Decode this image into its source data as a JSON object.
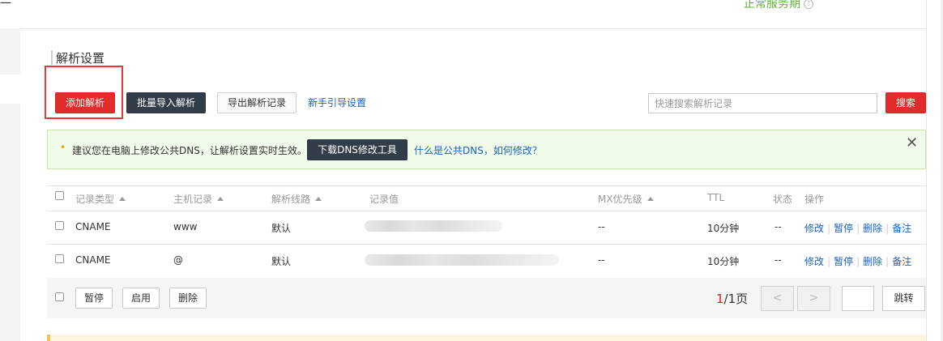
{
  "header": {
    "top_left_glyph": "一",
    "service_status": "正常服务期",
    "status_help_icon": "question-circle-icon"
  },
  "section_title": "解析设置",
  "toolbar": {
    "add_label": "添加解析",
    "batch_import_label": "批量导入解析",
    "export_label": "导出解析记录",
    "guide_link": "新手引导设置",
    "search_placeholder": "快速搜索解析记录",
    "search_button": "搜索"
  },
  "notice": {
    "bullet": "•",
    "text": "建议您在电脑上修改公共DNS，让解析设置实时生效。",
    "tool_button": "下载DNS修改工具",
    "help_link": "什么是公共DNS，如何修改？",
    "close_icon": "close-icon",
    "close_glyph": "✕"
  },
  "table": {
    "columns": {
      "type": "记录类型",
      "host": "主机记录",
      "line": "解析线路",
      "value": "记录值",
      "mx": "MX优先级",
      "ttl": "TTL",
      "status": "状态",
      "ops": "操作"
    },
    "rows": [
      {
        "type": "CNAME",
        "host": "www",
        "line": "默认",
        "value": "",
        "mx": "--",
        "ttl": "10分钟",
        "status": "--"
      },
      {
        "type": "CNAME",
        "host": "@",
        "line": "默认",
        "value": "",
        "mx": "--",
        "ttl": "10分钟",
        "status": "--"
      }
    ],
    "row_actions": {
      "edit": "修改",
      "pause": "暂停",
      "delete": "删除",
      "note": "备注",
      "separator": "|"
    }
  },
  "footer": {
    "pause_label": "暂停",
    "enable_label": "启用",
    "delete_label": "删除",
    "pager": {
      "current": "1",
      "total_text": "/1页"
    },
    "prev_glyph": "<",
    "next_glyph": ">",
    "jump_label": "跳转"
  },
  "colors": {
    "accent_red": "#e22b2b",
    "dark_button": "#333d4a",
    "link_blue": "#1a62b8",
    "status_green": "#5fb336",
    "notice_bg": "#f1fbe9"
  }
}
